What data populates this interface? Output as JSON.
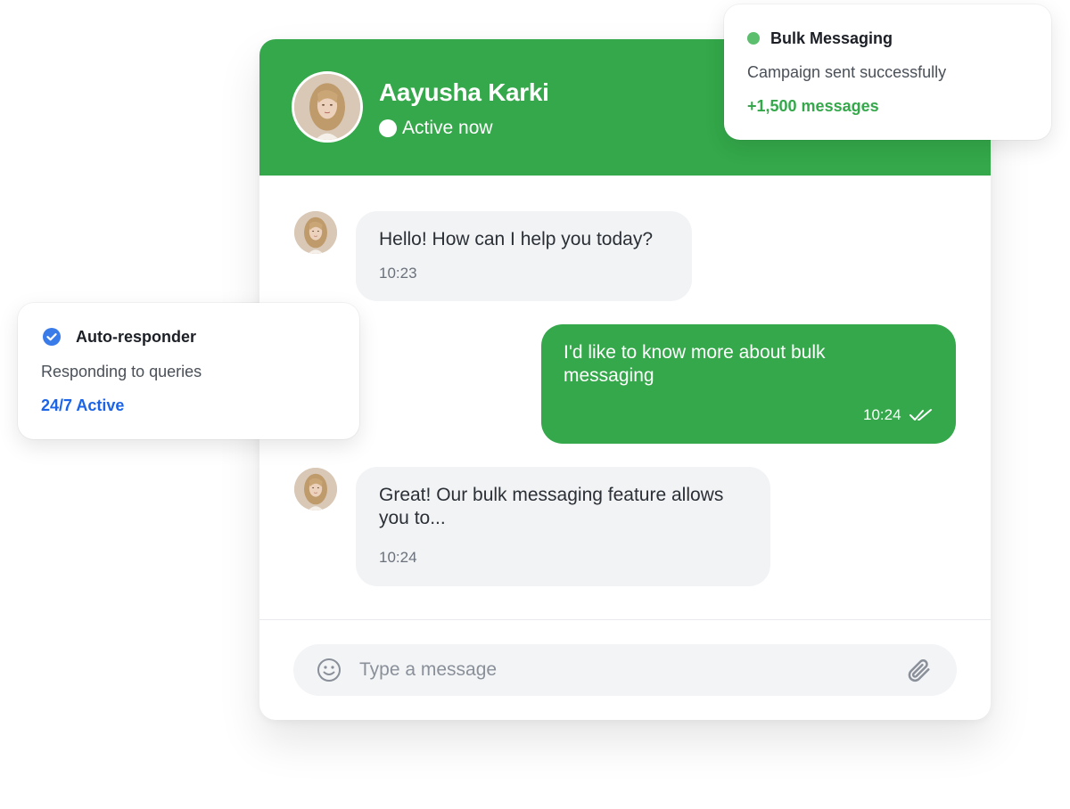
{
  "colors": {
    "brand_green": "#34a84a",
    "accent_blue": "#1b64e8",
    "check_blue": "#3a7bea",
    "incoming_bubble": "#f2f3f5",
    "status_dot_green": "#5bbf6e"
  },
  "chat": {
    "contact_name": "Aayusha Karki",
    "status": "Active now",
    "messages": [
      {
        "direction": "incoming",
        "text": "Hello! How can I help you today?",
        "time": "10:23"
      },
      {
        "direction": "outgoing",
        "text": "I'd like to know more about bulk messaging",
        "time": "10:24",
        "receipt_icon": "double-check-icon"
      },
      {
        "direction": "incoming",
        "text": "Great! Our bulk messaging feature allows you to...",
        "time": "10:24"
      }
    ],
    "input": {
      "placeholder": "Type a message",
      "left_icon": "emoji-icon",
      "right_icon": "paperclip-icon"
    }
  },
  "cards": {
    "bulk": {
      "title": "Bulk Messaging",
      "subtitle": "Campaign sent successfully",
      "metric": "+1,500 messages"
    },
    "auto": {
      "title": "Auto-responder",
      "subtitle": "Responding to queries",
      "metric": "24/7 Active"
    }
  }
}
